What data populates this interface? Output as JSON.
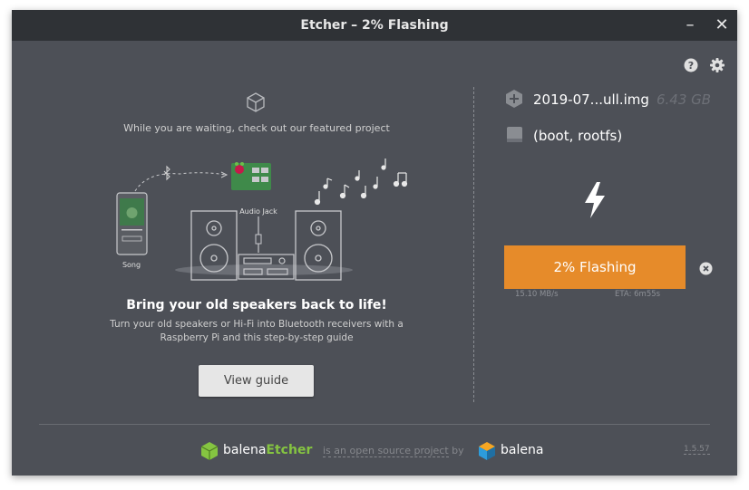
{
  "window": {
    "title": "Etcher – 2% Flashing",
    "minimize_glyph": "–",
    "close_glyph": "✕"
  },
  "toolbar": {
    "help_icon": "help-icon",
    "settings_icon": "gear-icon"
  },
  "featured": {
    "caption": "While you are waiting, check out our featured project",
    "labels": {
      "song": "Song",
      "audio_jack": "Audio Jack"
    },
    "headline": "Bring your old speakers back to life!",
    "description": "Turn your old speakers or Hi-Fi into Bluetooth receivers with a Raspberry Pi and this step-by-step guide",
    "button_label": "View guide"
  },
  "flash": {
    "image_name": "2019-07...ull.img",
    "image_size": "6.43 GB",
    "drive_name": "(boot, rootfs)",
    "button_label": "2% Flashing",
    "progress_percent": 2,
    "speed": "15.10 MB/s",
    "eta": "ETA: 6m55s"
  },
  "footer": {
    "brand_prefix": "balena",
    "brand_suffix": "Etcher",
    "text_prefix": "is",
    "link_text": "an open source project",
    "text_by": "by",
    "balena": "balena",
    "version": "1.5.57"
  },
  "colors": {
    "window_bg": "#4d5057",
    "titlebar_bg": "#2f3236",
    "accent_orange": "#e68b2a",
    "etcher_green": "#85c441",
    "balena_blue": "#2d9cdb",
    "balena_orange": "#f5a623"
  }
}
